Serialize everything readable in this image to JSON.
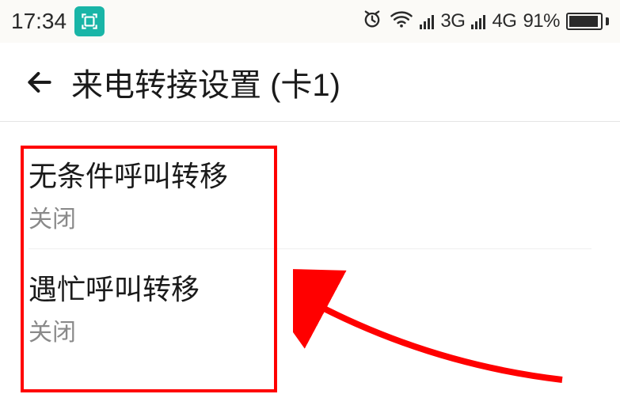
{
  "status_bar": {
    "time": "17:34",
    "network1_label": "3G",
    "network2_label": "4G",
    "battery_pct": "91%"
  },
  "header": {
    "title": "来电转接设置 (卡1)"
  },
  "settings": {
    "items": [
      {
        "title": "无条件呼叫转移",
        "status": "关闭"
      },
      {
        "title": "遇忙呼叫转移",
        "status": "关闭"
      }
    ]
  }
}
